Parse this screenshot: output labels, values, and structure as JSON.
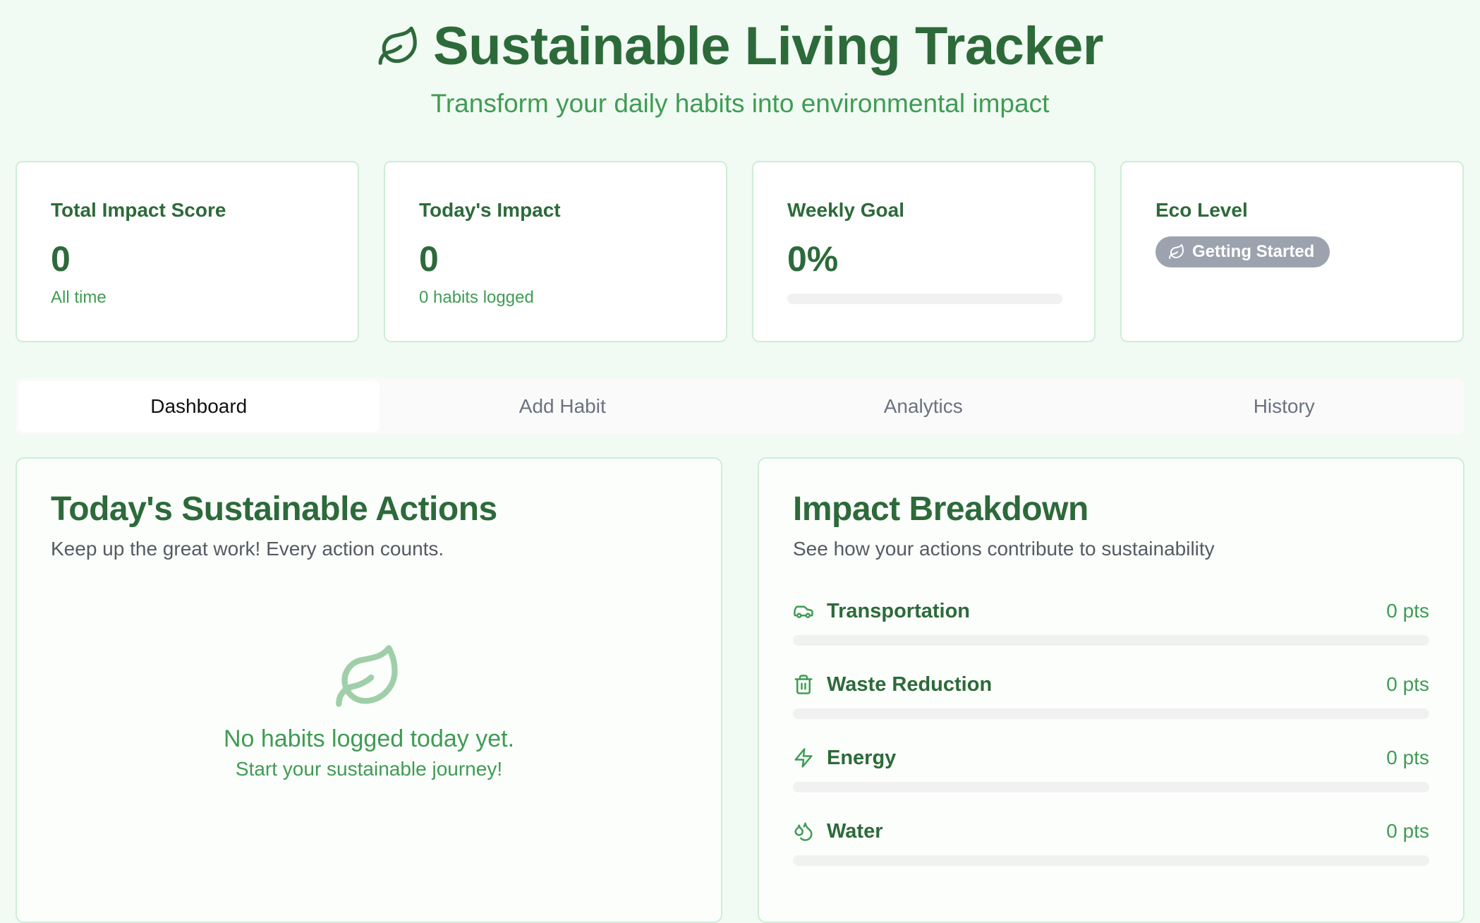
{
  "header": {
    "title": "Sustainable Living Tracker",
    "subtitle": "Transform your daily habits into environmental impact"
  },
  "stats": {
    "total": {
      "label": "Total Impact Score",
      "value": "0",
      "sub": "All time"
    },
    "today": {
      "label": "Today's Impact",
      "value": "0",
      "sub": "0 habits logged"
    },
    "weekly": {
      "label": "Weekly Goal",
      "value": "0%",
      "progress": 0
    },
    "eco": {
      "label": "Eco Level",
      "badge": "Getting Started",
      "badge_color": "#9ca3af"
    }
  },
  "tabs": [
    {
      "label": "Dashboard",
      "active": true
    },
    {
      "label": "Add Habit",
      "active": false
    },
    {
      "label": "Analytics",
      "active": false
    },
    {
      "label": "History",
      "active": false
    }
  ],
  "actions_panel": {
    "title": "Today's Sustainable Actions",
    "description": "Keep up the great work! Every action counts.",
    "empty_main": "No habits logged today yet.",
    "empty_sub": "Start your sustainable journey!"
  },
  "breakdown_panel": {
    "title": "Impact Breakdown",
    "description": "See how your actions contribute to sustainability",
    "categories": [
      {
        "label": "Transportation",
        "points": "0 pts",
        "icon": "car-icon",
        "progress": 0
      },
      {
        "label": "Waste Reduction",
        "points": "0 pts",
        "icon": "trash-icon",
        "progress": 0
      },
      {
        "label": "Energy",
        "points": "0 pts",
        "icon": "lightning-icon",
        "progress": 0
      },
      {
        "label": "Water",
        "points": "0 pts",
        "icon": "droplets-icon",
        "progress": 0
      }
    ]
  },
  "colors": {
    "primary": "#2d6a3a",
    "accent": "#3f9c54",
    "background": "#f1faf3",
    "border": "#cdeed6"
  }
}
